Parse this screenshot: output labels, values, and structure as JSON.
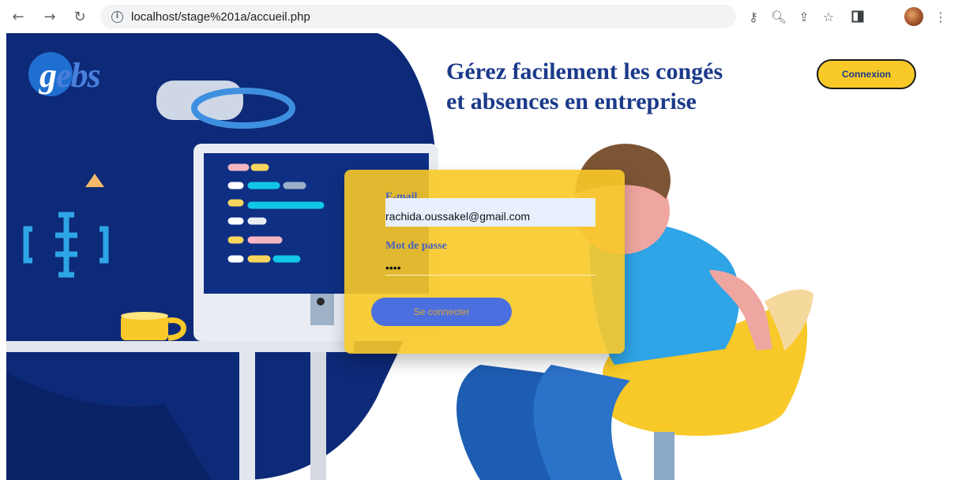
{
  "browser": {
    "url": "localhost/stage%201a/accueil.php",
    "icons": [
      "back-arrow-icon",
      "forward-arrow-icon",
      "reload-icon",
      "site-info-icon",
      "key-icon",
      "zoom-icon",
      "share-icon",
      "star-icon",
      "sidepanel-icon",
      "profile-avatar",
      "menu-dots-icon"
    ]
  },
  "logo": {
    "first_letter": "g",
    "rest": "ebs"
  },
  "hero": {
    "headline_line1": "Gérez facilement les congés",
    "headline_line2": "et absences en entreprise",
    "connexion_label": "Connexion"
  },
  "login": {
    "email_label": "E-mail",
    "email_value": "rachida.oussakel@gmail.com",
    "password_label": "Mot de passe",
    "password_value": "••••",
    "submit_label": "Se connecter"
  },
  "colors": {
    "navy": "#0d2a78",
    "yellow": "#f8c928",
    "blue_button": "#4b6fde",
    "headline": "#1b3a8a"
  }
}
